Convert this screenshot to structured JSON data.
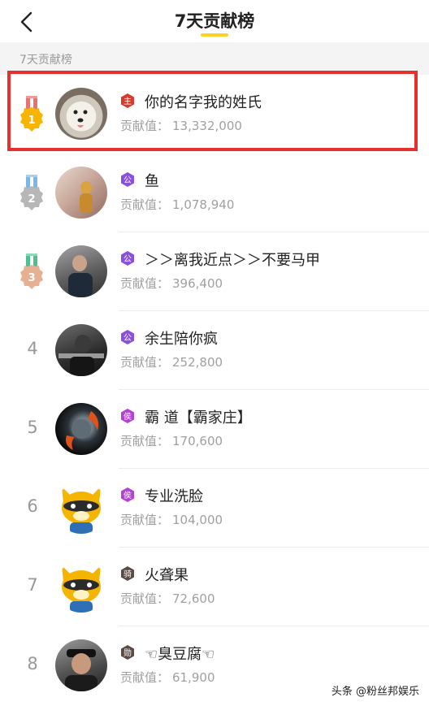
{
  "header": {
    "title": "7天贡献榜"
  },
  "section": {
    "label": "7天贡献榜"
  },
  "contrib_label": "贡献值：",
  "rows": [
    {
      "rank": "1",
      "badge": "主",
      "name": "你的名字我的姓氏",
      "value": "13,332,000"
    },
    {
      "rank": "2",
      "badge": "公",
      "name": "鱼",
      "value": "1,078,940"
    },
    {
      "rank": "3",
      "badge": "公",
      "name": "＞＞离我近点＞＞不要马甲",
      "value": "396,400"
    },
    {
      "rank": "4",
      "badge": "公",
      "name": "余生陪你疯",
      "value": "252,800"
    },
    {
      "rank": "5",
      "badge": "侯",
      "name": "霸 道【霸家庄】",
      "value": "170,600"
    },
    {
      "rank": "6",
      "badge": "侯",
      "name": "专业洗脸",
      "value": "104,000"
    },
    {
      "rank": "7",
      "badge": "骑",
      "name": "火聋果",
      "value": "72,600"
    },
    {
      "rank": "8",
      "badge": "勋",
      "name": "☜臭豆腐☜",
      "value": "61,900"
    }
  ],
  "colors": {
    "accent": "#ffd21f",
    "highlight": "#e4312d",
    "badge_red": "#d93a2b",
    "badge_purple": "#8a4fe0",
    "badge_magenta": "#b341d6",
    "badge_dark": "#5a4b45"
  },
  "watermark": "头条 @粉丝邦娱乐"
}
